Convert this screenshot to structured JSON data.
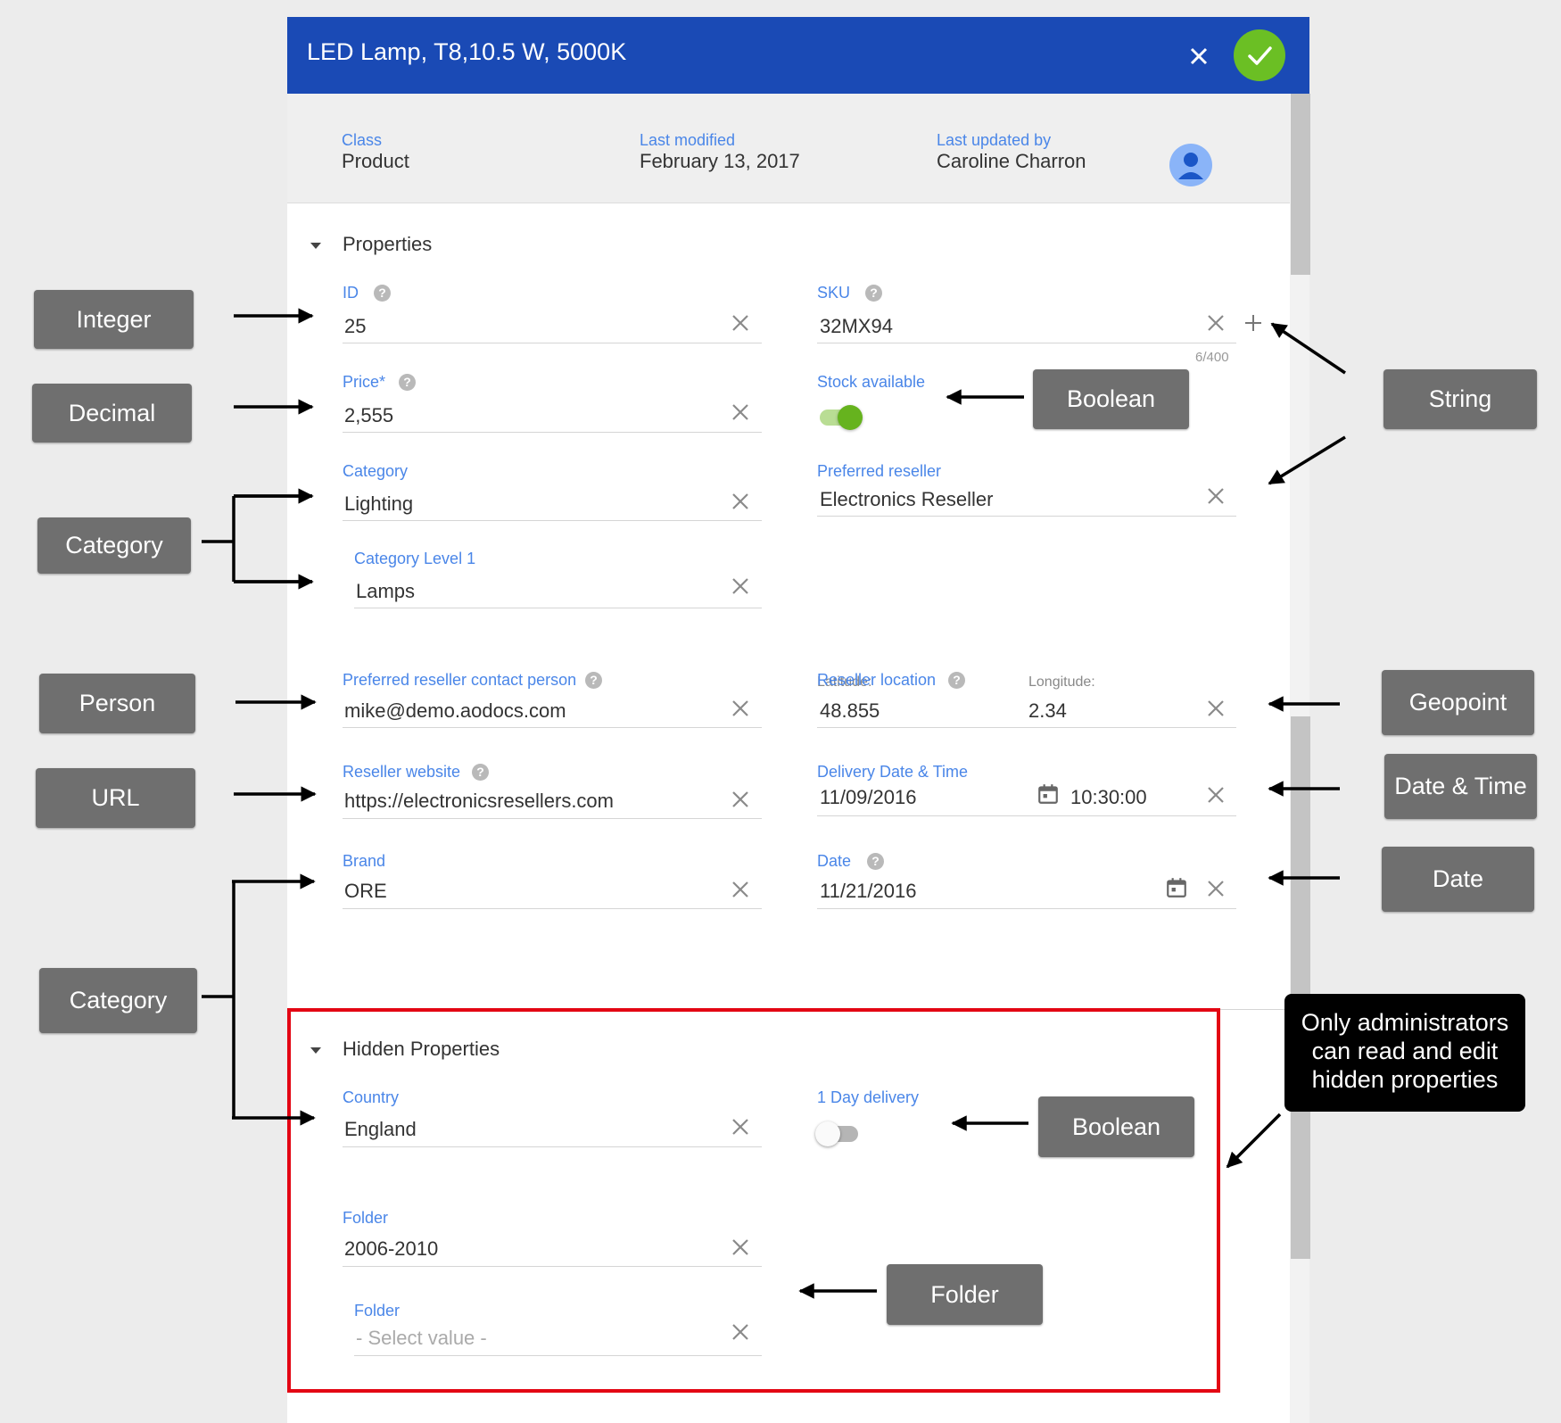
{
  "dialog": {
    "title": "LED Lamp, T8,10.5 W, 5000K",
    "meta": {
      "class_label": "Class",
      "class_value": "Product",
      "modified_label": "Last modified",
      "modified_value": "February 13, 2017",
      "updated_label": "Last updated by",
      "updated_value": "Caroline Charron"
    },
    "properties": {
      "heading": "Properties",
      "id": {
        "label": "ID",
        "value": "25"
      },
      "sku": {
        "label": "SKU",
        "value": "32MX94",
        "counter": "6/400"
      },
      "price": {
        "label": "Price*",
        "value": "2,555"
      },
      "stock": {
        "label": "Stock available",
        "on": true
      },
      "category": {
        "label": "Category",
        "value": "Lighting"
      },
      "category_level1": {
        "label": "Category Level 1",
        "value": "Lamps"
      },
      "preferred_reseller": {
        "label": "Preferred reseller",
        "value": "Electronics Reseller"
      },
      "contact_person": {
        "label": "Preferred reseller contact person",
        "value": "mike@demo.aodocs.com"
      },
      "reseller_location": {
        "label": "Reseller location",
        "latitude_label": "Latitude:",
        "latitude": "48.855",
        "longitude_label": "Longitude:",
        "longitude": "2.34"
      },
      "reseller_website": {
        "label": "Reseller website",
        "value": "https://electronicsresellers.com"
      },
      "delivery": {
        "label": "Delivery Date & Time",
        "date": "11/09/2016",
        "time": "10:30:00"
      },
      "brand": {
        "label": "Brand",
        "value": "ORE"
      },
      "date": {
        "label": "Date",
        "value": "11/21/2016"
      }
    },
    "hidden": {
      "heading": "Hidden Properties",
      "country": {
        "label": "Country",
        "value": "England"
      },
      "day_delivery": {
        "label": "1 Day delivery",
        "on": false
      },
      "folder": {
        "label": "Folder",
        "value": "2006-2010"
      },
      "folder2": {
        "label": "Folder",
        "placeholder": "- Select value -"
      }
    }
  },
  "callouts": {
    "integer": "Integer",
    "decimal": "Decimal",
    "category_top": "Category",
    "person": "Person",
    "url": "URL",
    "category_bottom": "Category",
    "boolean_top": "Boolean",
    "string": "String",
    "geopoint": "Geopoint",
    "datetime": "Date & Time",
    "date": "Date",
    "boolean_bottom": "Boolean",
    "folder": "Folder",
    "admin_note": [
      "Only administrators",
      "can read and edit",
      "hidden properties"
    ]
  },
  "colors": {
    "header_blue": "#1a4ab5",
    "save_green": "#6bbf24",
    "label_blue": "#4a86e8",
    "callout_grey": "#6f6f6f",
    "highlight_red": "#e30613",
    "toggle_on": "#66b31e"
  },
  "icons": {
    "close": "close-icon",
    "save": "check-icon",
    "clear": "clear-x-icon",
    "help": "help-icon",
    "calendar": "calendar-icon",
    "add": "plus-icon",
    "collapse": "caret-down-icon",
    "avatar": "person-icon"
  }
}
